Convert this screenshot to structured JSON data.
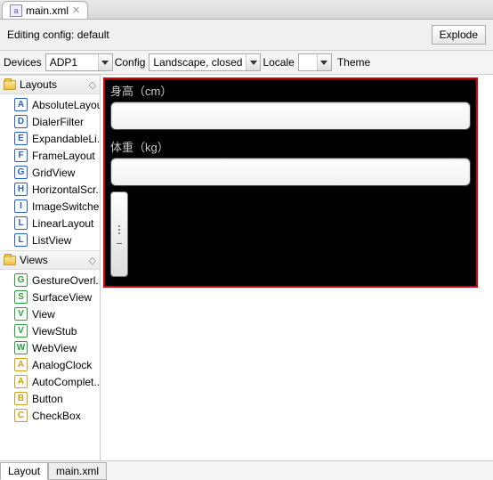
{
  "tab": {
    "filename": "main.xml",
    "close": "✕"
  },
  "config_line": "Editing config: default",
  "explode_btn": "Explode",
  "toolbar": {
    "devices_label": "Devices",
    "devices_value": "ADP1",
    "config_label": "Config",
    "config_value": "Landscape, closed",
    "locale_label": "Locale",
    "locale_value": "",
    "theme_label": "Theme"
  },
  "palette": {
    "layouts": {
      "title": "Layouts",
      "items": [
        {
          "letter": "A",
          "color": "#2a5fd0",
          "label": "AbsoluteLayout"
        },
        {
          "letter": "D",
          "color": "#2a5fd0",
          "label": "DialerFilter"
        },
        {
          "letter": "E",
          "color": "#2a5fd0",
          "label": "ExpandableLi..."
        },
        {
          "letter": "F",
          "color": "#2a5fd0",
          "label": "FrameLayout"
        },
        {
          "letter": "G",
          "color": "#2a5fd0",
          "label": "GridView"
        },
        {
          "letter": "H",
          "color": "#2a5fd0",
          "label": "HorizontalScr..."
        },
        {
          "letter": "I",
          "color": "#2a5fd0",
          "label": "ImageSwitcher"
        },
        {
          "letter": "L",
          "color": "#2a5fd0",
          "label": "LinearLayout"
        },
        {
          "letter": "L",
          "color": "#2a5fd0",
          "label": "ListView"
        }
      ]
    },
    "views": {
      "title": "Views",
      "items": [
        {
          "letter": "G",
          "color": "#2aa040",
          "label": "GestureOverl..."
        },
        {
          "letter": "S",
          "color": "#2aa040",
          "label": "SurfaceView"
        },
        {
          "letter": "V",
          "color": "#2aa040",
          "label": "View"
        },
        {
          "letter": "V",
          "color": "#2aa040",
          "label": "ViewStub"
        },
        {
          "letter": "W",
          "color": "#2aa040",
          "label": "WebView"
        },
        {
          "letter": "A",
          "color": "#d0a010",
          "label": "AnalogClock"
        },
        {
          "letter": "A",
          "color": "#d0a010",
          "label": "AutoComplet..."
        },
        {
          "letter": "B",
          "color": "#d0a010",
          "label": "Button"
        },
        {
          "letter": "C",
          "color": "#d0a010",
          "label": "CheckBox"
        }
      ]
    }
  },
  "device": {
    "field1_label": "身高（cm）",
    "field2_label": "体重（kg）"
  },
  "bottom_tabs": {
    "layout": "Layout",
    "source": "main.xml"
  }
}
